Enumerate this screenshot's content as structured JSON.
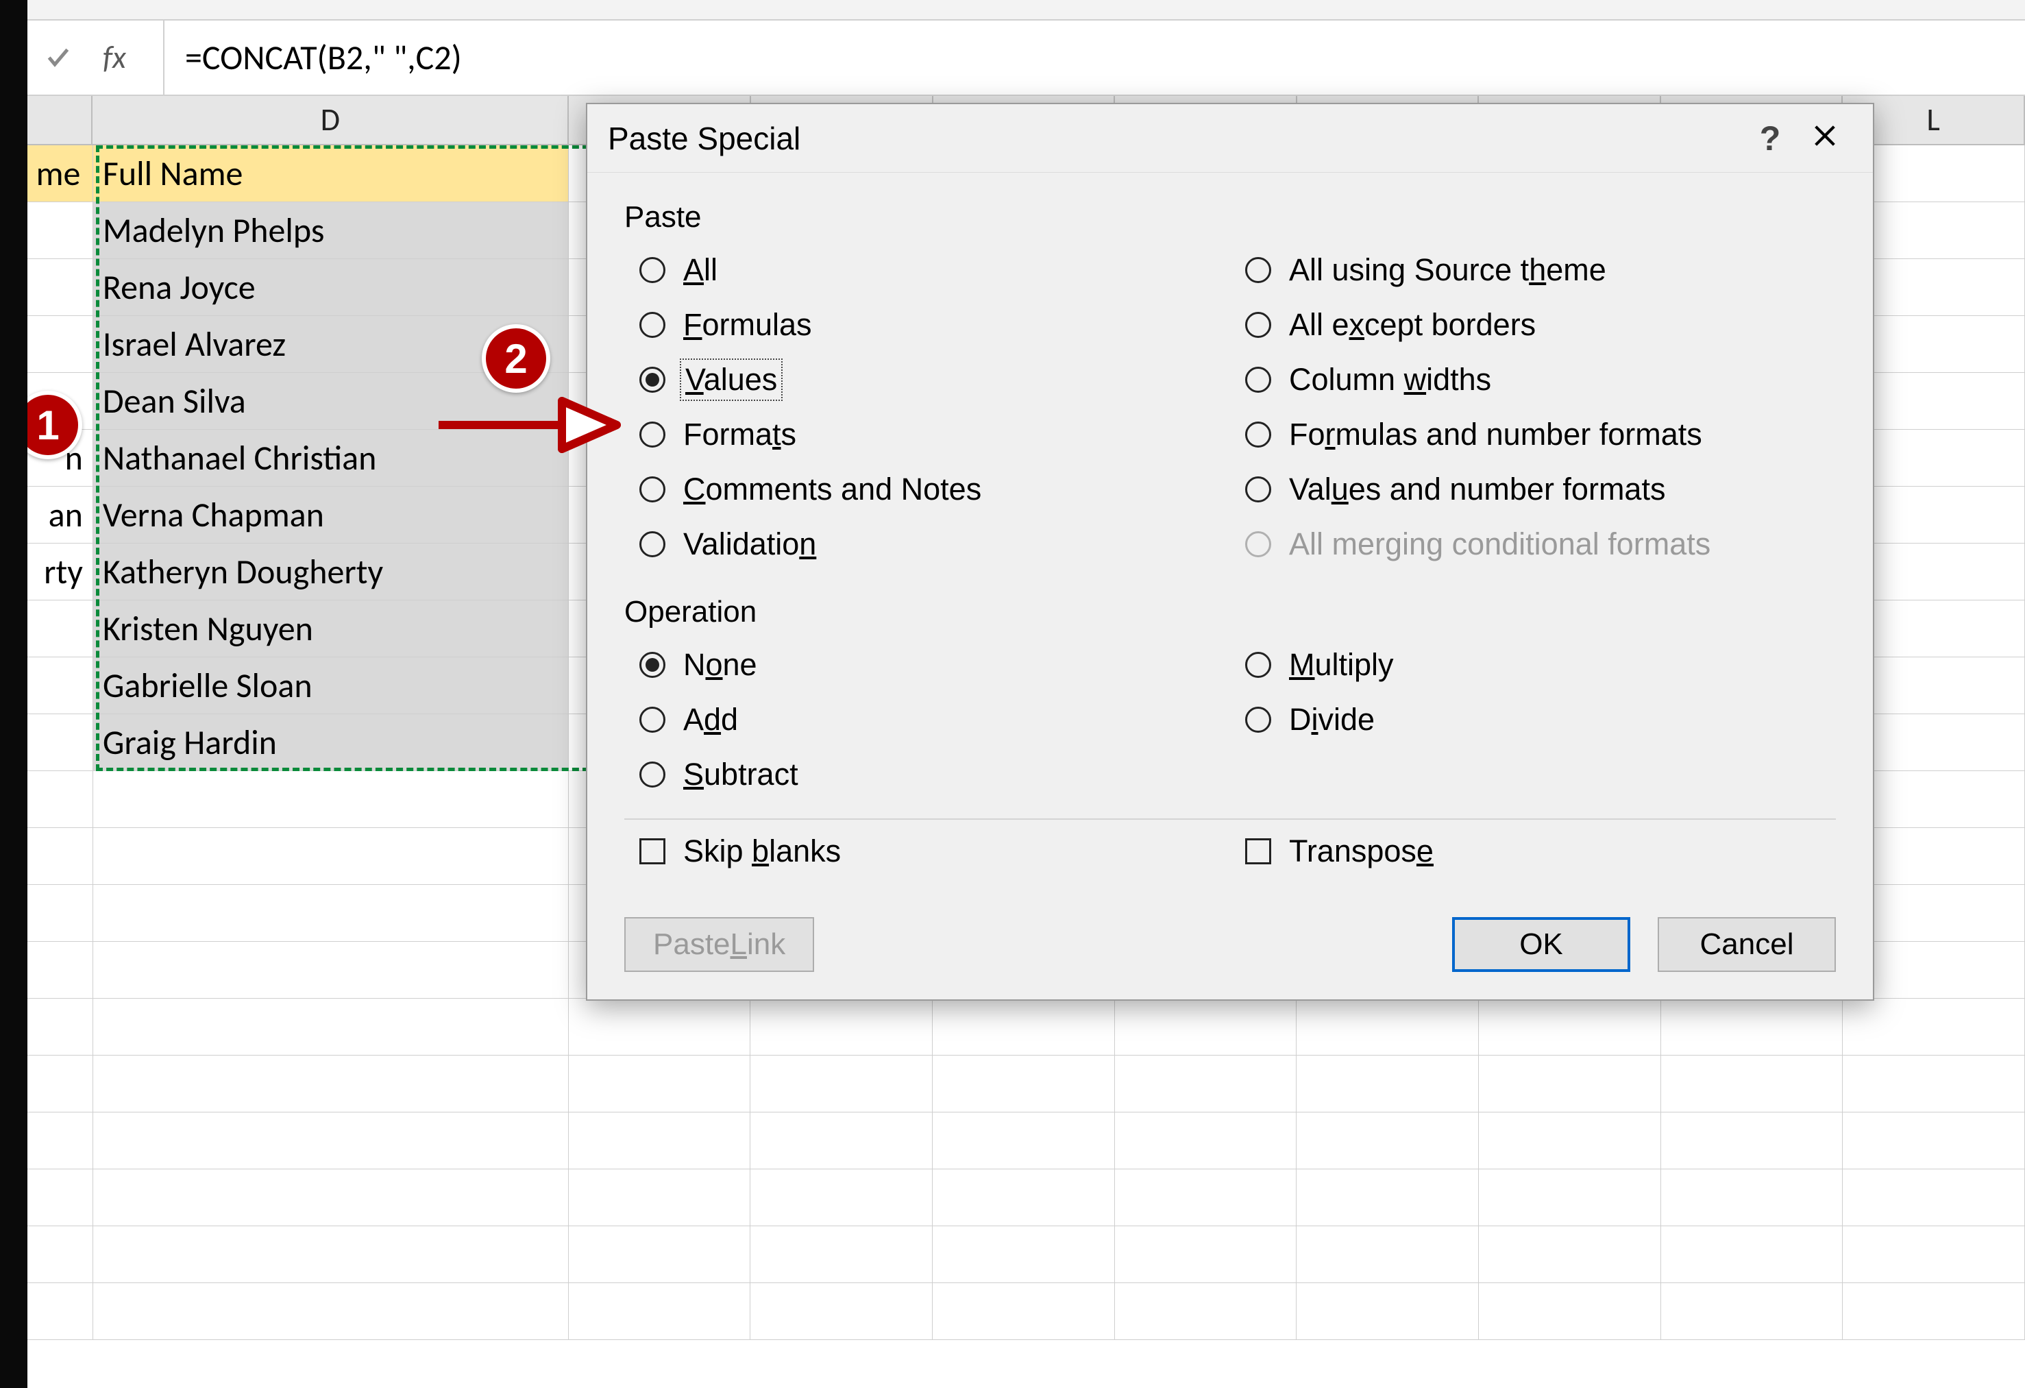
{
  "formula_bar": {
    "fx_label": "fx",
    "formula": "=CONCAT(B2,\" \",C2)"
  },
  "columns": {
    "c_frag": "me",
    "d_header": "D",
    "l_header": "L"
  },
  "header_row": {
    "c_frag": "me",
    "d": "Full Name"
  },
  "data_rows": [
    {
      "c": "",
      "d": "Madelyn Phelps"
    },
    {
      "c": "",
      "d": "Rena Joyce"
    },
    {
      "c": "",
      "d": "Israel Alvarez"
    },
    {
      "c": "",
      "d": "Dean Silva"
    },
    {
      "c": "n",
      "d": "Nathanael Christian"
    },
    {
      "c": "an",
      "d": "Verna Chapman"
    },
    {
      "c": "rty",
      "d": "Katheryn Dougherty"
    },
    {
      "c": "",
      "d": "Kristen Nguyen"
    },
    {
      "c": "",
      "d": "Gabrielle Sloan"
    },
    {
      "c": "",
      "d": "Graig Hardin"
    }
  ],
  "dialog": {
    "title": "Paste Special",
    "sections": {
      "paste": "Paste",
      "operation": "Operation"
    },
    "paste_options": {
      "left": [
        {
          "key": "all",
          "pre": "",
          "u": "A",
          "post": "ll",
          "checked": false
        },
        {
          "key": "formulas",
          "pre": "",
          "u": "F",
          "post": "ormulas",
          "checked": false
        },
        {
          "key": "values",
          "pre": "",
          "u": "V",
          "post": "alues",
          "checked": true,
          "focused": true
        },
        {
          "key": "formats",
          "pre": "Forma",
          "u": "t",
          "post": "s",
          "checked": false
        },
        {
          "key": "comments",
          "pre": "",
          "u": "C",
          "post": "omments and Notes",
          "checked": false
        },
        {
          "key": "validation",
          "pre": "Validatio",
          "u": "n",
          "post": "",
          "checked": false
        }
      ],
      "right": [
        {
          "key": "source-theme",
          "pre": "All using Source t",
          "u": "h",
          "post": "eme",
          "checked": false
        },
        {
          "key": "except-borders",
          "pre": "All e",
          "u": "x",
          "post": "cept borders",
          "checked": false
        },
        {
          "key": "col-widths",
          "pre": "Column ",
          "u": "w",
          "post": "idths",
          "checked": false
        },
        {
          "key": "formulas-num",
          "pre": "Fo",
          "u": "r",
          "post": "mulas and number formats",
          "checked": false
        },
        {
          "key": "values-num",
          "pre": "Val",
          "u": "u",
          "post": "es and number formats",
          "checked": false
        },
        {
          "key": "merge-cond",
          "pre": "All mergin",
          "u": "g",
          "post": " conditional formats",
          "checked": false,
          "disabled": true
        }
      ]
    },
    "operation_options": {
      "left": [
        {
          "key": "none",
          "pre": "N",
          "u": "o",
          "post": "ne",
          "checked": true
        },
        {
          "key": "add",
          "pre": "A",
          "u": "d",
          "post": "d",
          "checked": false
        },
        {
          "key": "subtract",
          "pre": "",
          "u": "S",
          "post": "ubtract",
          "checked": false
        }
      ],
      "right": [
        {
          "key": "multiply",
          "pre": "",
          "u": "M",
          "post": "ultiply",
          "checked": false
        },
        {
          "key": "divide",
          "pre": "D",
          "u": "i",
          "post": "vide",
          "checked": false
        }
      ]
    },
    "checks": {
      "skip_blanks": {
        "pre": "Skip ",
        "u": "b",
        "post": "lanks",
        "checked": false
      },
      "transpose": {
        "pre": "Transpos",
        "u": "e",
        "post": "",
        "checked": false
      }
    },
    "buttons": {
      "paste_link": {
        "pre": "Paste ",
        "u": "L",
        "post": "ink",
        "disabled": true
      },
      "ok": "OK",
      "cancel": "Cancel"
    }
  },
  "callouts": {
    "badge1": "1",
    "badge2": "2"
  }
}
